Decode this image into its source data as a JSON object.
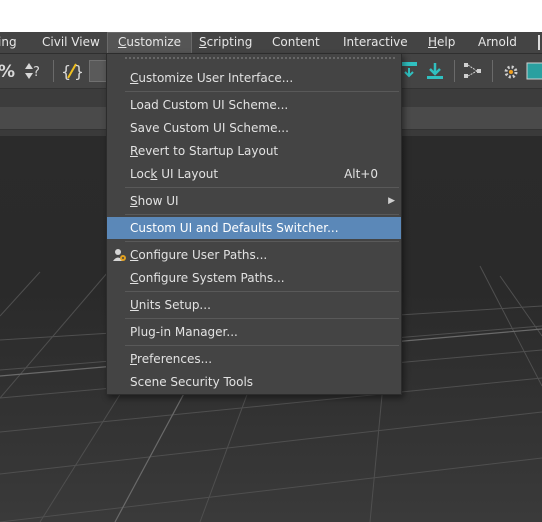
{
  "menubar": {
    "items": [
      {
        "label": "ing"
      },
      {
        "label": "Civil View"
      },
      {
        "label": "Customize",
        "underline": "C"
      },
      {
        "label": "Scripting",
        "underline": "S"
      },
      {
        "label": "Content"
      },
      {
        "label": "Interactive"
      },
      {
        "label": "Help",
        "underline": "H"
      },
      {
        "label": "Arnold"
      }
    ]
  },
  "dropdown": {
    "items": [
      {
        "label": "Customize User Interface...",
        "ul": "C",
        "rest": "ustomize User Interface..."
      },
      {
        "label": "Load Custom UI Scheme..."
      },
      {
        "label": "Save Custom UI Scheme..."
      },
      {
        "label": "Revert to Startup Layout",
        "ul": "R",
        "rest": "evert to Startup Layout"
      },
      {
        "label": "Lock UI Layout",
        "pre": "Loc",
        "ul": "k",
        "rest": " UI Layout",
        "shortcut": "Alt+0"
      },
      {
        "label": "Show UI",
        "ul": "S",
        "rest": "how UI"
      },
      {
        "label": "Custom UI and Defaults Switcher..."
      },
      {
        "label": "Configure User Paths...",
        "ul": "C",
        "rest": "onfigure User Paths..."
      },
      {
        "label": "Configure System Paths...",
        "ul": "C",
        "rest": "onfigure System Paths..."
      },
      {
        "label": "Units Setup...",
        "ul": "U",
        "rest": "nits Setup..."
      },
      {
        "label": "Plug-in Manager..."
      },
      {
        "label": "Preferences...",
        "ul": "P",
        "rest": "references..."
      },
      {
        "label": "Scene Security Tools"
      }
    ]
  },
  "colors": {
    "menu_bg": "#444444",
    "highlight": "#5b88b8",
    "viewport_grid": "#5a5a5a"
  }
}
